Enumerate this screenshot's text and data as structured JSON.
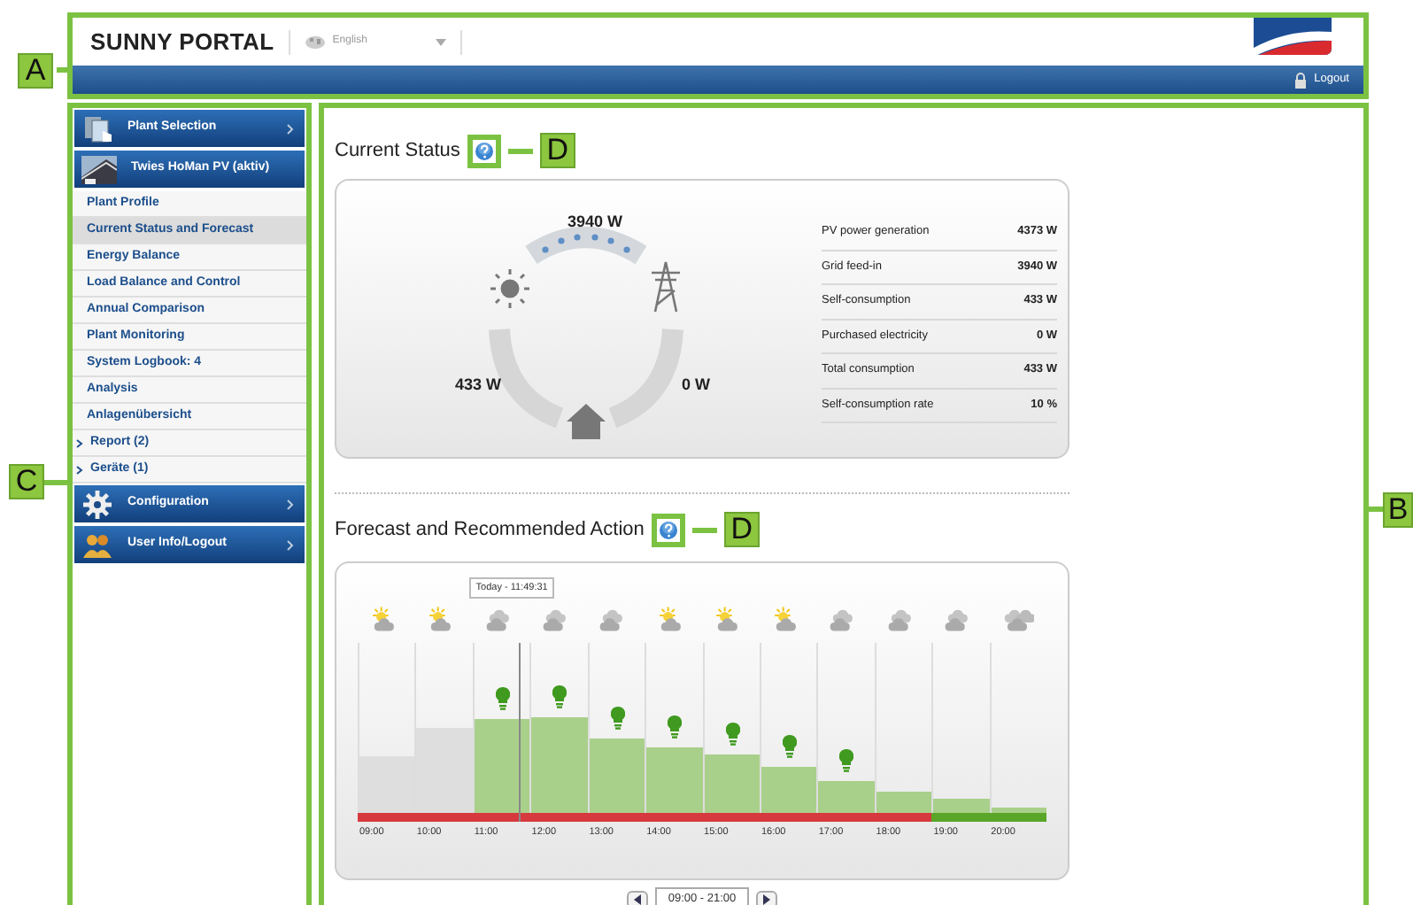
{
  "header": {
    "callout": "A",
    "logo_text": "SUNNY PORTAL",
    "language": "English",
    "logout": "Logout"
  },
  "sidebar": {
    "callout": "C",
    "items": [
      {
        "kind": "selection",
        "label": "Plant Selection"
      },
      {
        "kind": "plant",
        "label": "Twies HoMan PV (aktiv)"
      },
      {
        "kind": "link",
        "label": "Plant Profile",
        "selected": false
      },
      {
        "kind": "link",
        "label": "Current Status and Forecast",
        "selected": true
      },
      {
        "kind": "link",
        "label": "Energy Balance",
        "selected": false
      },
      {
        "kind": "link",
        "label": "Load Balance and Control",
        "selected": false
      },
      {
        "kind": "link",
        "label": "Annual Comparison",
        "selected": false
      },
      {
        "kind": "link",
        "label": "Plant Monitoring",
        "selected": false
      },
      {
        "kind": "link",
        "label": "System Logbook: 4",
        "selected": false
      },
      {
        "kind": "link",
        "label": "Analysis",
        "selected": false
      },
      {
        "kind": "link",
        "label": "Anlagenübersicht",
        "selected": false
      },
      {
        "kind": "group",
        "label": "Report (2)",
        "expanded": false
      },
      {
        "kind": "group",
        "label": "Geräte (1)",
        "expanded": false
      },
      {
        "kind": "settings",
        "label": "Configuration"
      },
      {
        "kind": "account",
        "label": "User Info/Logout"
      }
    ]
  },
  "main": {
    "callout": "B"
  },
  "current_status": {
    "title": "Current Status",
    "callout": "D",
    "flow": {
      "grid_feed_in": "3940 W",
      "self_consumption": "433 W",
      "purchased": "0 W"
    },
    "stats": [
      {
        "label": "PV power generation",
        "value": "4373 W"
      },
      {
        "label": "Grid feed-in",
        "value": "3940 W"
      },
      {
        "label": "Self-consumption",
        "value": "433 W"
      },
      {
        "label": "Purchased electricity",
        "value": "0 W"
      },
      {
        "label": "Total consumption",
        "value": "433 W"
      },
      {
        "label": "Self-consumption rate",
        "value": "10 %"
      }
    ]
  },
  "forecast": {
    "title": "Forecast and Recommended Action",
    "callout": "D",
    "now_marker": "Today - 11:49:31",
    "range": "09:00 - 21:00",
    "columns": [
      {
        "time": "09:00",
        "kind": "sun-cloud",
        "past": true,
        "level": 0.33,
        "recommended": false,
        "now": false,
        "color": "#d63a3f"
      },
      {
        "time": "10:00",
        "kind": "sun-cloud",
        "past": true,
        "level": 0.5,
        "recommended": false,
        "now": false,
        "color": "#d63a3f"
      },
      {
        "time": "11:00",
        "kind": "cloud",
        "past": false,
        "level": 0.55,
        "recommended": true,
        "now": true,
        "color": "#d63a3f"
      },
      {
        "time": "12:00",
        "kind": "cloud",
        "past": false,
        "level": 0.56,
        "recommended": true,
        "now": false,
        "color": "#d63a3f"
      },
      {
        "time": "13:00",
        "kind": "cloud",
        "past": false,
        "level": 0.44,
        "recommended": true,
        "now": false,
        "color": "#d63a3f"
      },
      {
        "time": "14:00",
        "kind": "sun-cloud",
        "past": false,
        "level": 0.39,
        "recommended": true,
        "now": false,
        "color": "#d63a3f"
      },
      {
        "time": "15:00",
        "kind": "sun-cloud",
        "past": false,
        "level": 0.34,
        "recommended": true,
        "now": false,
        "color": "#d63a3f"
      },
      {
        "time": "16:00",
        "kind": "sun-cloud",
        "past": false,
        "level": 0.27,
        "recommended": true,
        "now": false,
        "color": "#d63a3f"
      },
      {
        "time": "17:00",
        "kind": "cloud",
        "past": false,
        "level": 0.19,
        "recommended": true,
        "now": false,
        "color": "#d63a3f"
      },
      {
        "time": "18:00",
        "kind": "cloud",
        "past": false,
        "level": 0.12,
        "recommended": false,
        "now": false,
        "color": "#d63a3f"
      },
      {
        "time": "19:00",
        "kind": "cloud",
        "past": false,
        "level": 0.08,
        "recommended": false,
        "now": false,
        "color": "#5aa628"
      },
      {
        "time": "20:00",
        "kind": "clouds",
        "past": false,
        "level": 0.03,
        "recommended": false,
        "now": false,
        "color": "#5aa628"
      }
    ]
  }
}
